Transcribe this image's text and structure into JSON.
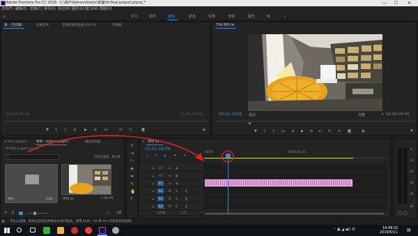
{
  "window": {
    "title": "Adobe Premiere Pro CC 2018 - C:\\用户\\Administrator\\桌面\\fd final project.prproj *",
    "controls": [
      "—",
      "☐",
      "✕"
    ]
  },
  "menu": [
    "文件(F)",
    "编辑(E)",
    "剪辑(C)",
    "序列(S)",
    "标记(M)",
    "图形(G)",
    "窗口(W)",
    "帮助(H)"
  ],
  "workspaces": [
    "学习",
    "组件",
    "编辑",
    "颜色",
    "效果",
    "音频",
    "图形",
    "库"
  ],
  "workspace_active": "编辑",
  "source_panel": {
    "tabs": [
      "源：(无剪辑)",
      "效果控件",
      "音频剪辑混合器:序列 04",
      "元数据"
    ],
    "timecode_left": "00;00;00;00",
    "timecode_right": "00;00;00;00"
  },
  "program_panel": {
    "tab": "节目:序列 04",
    "timecode": "00:01:18:06",
    "fit": "适合",
    "quality": "完整",
    "duration": "00:00:05:00"
  },
  "project_panel": {
    "tabs": [
      "fd final project",
      "项目：fd final project",
      "媒体浏览器"
    ],
    "path": "fd final project.prproj",
    "selection_info": "1项已选择，共2项",
    "items": [
      {
        "name": "序列",
        "meta": "0:00"
      },
      {
        "name": "序列 04",
        "meta": "5:00:00"
      }
    ]
  },
  "timeline_panel": {
    "tab": "序列 04",
    "timecode": "00:01:18:06",
    "ruler": [
      "00:00",
      "00:00:05:00"
    ],
    "tracks": [
      {
        "name": "V3",
        "label": "V3"
      },
      {
        "name": "V2",
        "label": "V2"
      },
      {
        "name": "V1",
        "label": "V1"
      },
      {
        "name": "A1",
        "label": "A1"
      },
      {
        "name": "A2",
        "label": "A2"
      },
      {
        "name": "A3",
        "label": "A3"
      }
    ],
    "master": "主声道",
    "master_value": "0.0"
  },
  "meter_labels": [
    "0",
    "-12",
    "-24",
    "-36",
    "-48",
    "dB"
  ],
  "status_text": "单击以选择，或单击空白处并拖动以进行框选。使用 Shift、Alt 和 Ctrl 可获得其他选项。",
  "clock": {
    "time": "14:49:31",
    "date": "2019/5/11"
  },
  "colors": {
    "accent": "#2d8ceb",
    "audio_clip": "#d98bd2",
    "annotation": "#e02020",
    "work_area": "#d8d84a"
  }
}
